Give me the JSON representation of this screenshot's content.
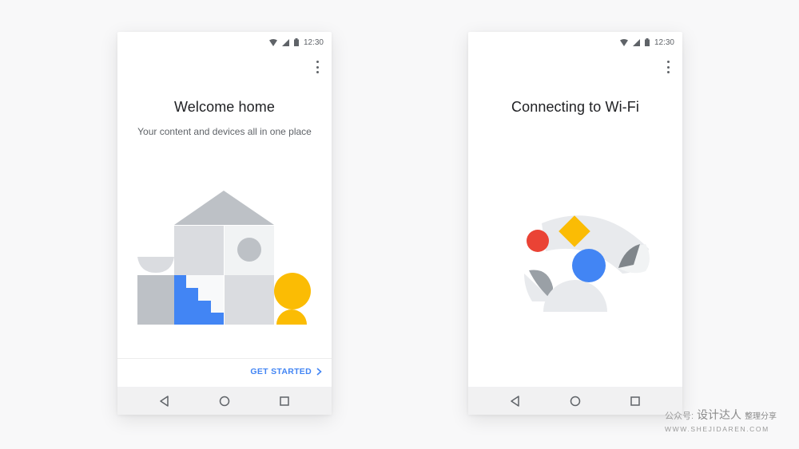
{
  "colors": {
    "blue": "#4285f4",
    "red": "#ea4335",
    "yellow": "#fbbc04",
    "grey_light": "#dadce0",
    "grey_mid": "#bdc1c6",
    "grey_dark": "#9aa0a6"
  },
  "screens": [
    {
      "status": {
        "time": "12:30",
        "icons": [
          "wifi-icon",
          "signal-icon",
          "battery-icon"
        ]
      },
      "title": "Welcome home",
      "subtitle": "Your content and devices all in one place",
      "action_label": "GET STARTED",
      "action_icon": "chevron-right-icon",
      "nav": [
        "back-icon",
        "home-icon",
        "recents-icon"
      ]
    },
    {
      "status": {
        "time": "12:30",
        "icons": [
          "wifi-icon",
          "signal-icon",
          "battery-icon"
        ]
      },
      "title": "Connecting to Wi-Fi",
      "nav": [
        "back-icon",
        "home-icon",
        "recents-icon"
      ]
    }
  ],
  "watermark": {
    "prefix": "公众号:",
    "brand": "设计达人",
    "suffix": "整理分享",
    "url": "WWW.SHEJIDAREN.COM"
  }
}
